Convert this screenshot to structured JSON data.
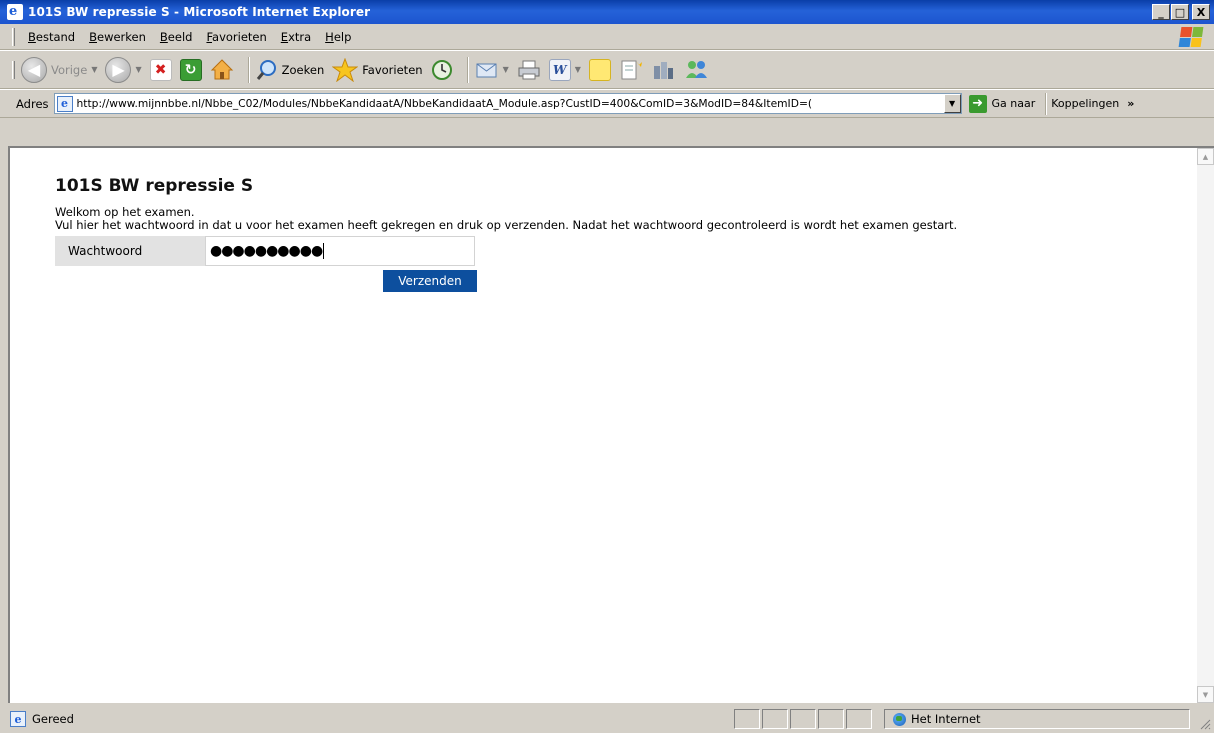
{
  "window": {
    "title": "101S BW repressie S - Microsoft Internet Explorer",
    "minimize": "_",
    "maximize": "□",
    "close": "X"
  },
  "menubar": {
    "items": [
      "Bestand",
      "Bewerken",
      "Beeld",
      "Favorieten",
      "Extra",
      "Help"
    ]
  },
  "toolbar": {
    "back_label": "Vorige",
    "search_label": "Zoeken",
    "favorites_label": "Favorieten"
  },
  "address": {
    "label": "Adres",
    "url": "http://www.mijnnbbe.nl/Nbbe_C02/Modules/NbbeKandidaatA/NbbeKandidaatA_Module.asp?CustID=400&ComID=3&ModID=84&ItemID=(",
    "go_label": "Ga naar",
    "links_label": "Koppelingen",
    "links_chevron": "»"
  },
  "page": {
    "title": "101S BW repressie S",
    "welcome": "Welkom op het examen.",
    "instructions": "Vul hier het wachtwoord in dat u voor het examen heeft gekregen en druk op verzenden. Nadat het wachtwoord gecontroleerd is wordt het examen gestart.",
    "password_label": "Wachtwoord",
    "password_dots": "●●●●●●●●●●",
    "submit_label": "Verzenden"
  },
  "status": {
    "text": "Gereed",
    "zone": "Het Internet"
  },
  "colors": {
    "titlebar": "#1c55cf",
    "submit_button": "#0d4f9e",
    "window_face": "#d4d0c8"
  }
}
